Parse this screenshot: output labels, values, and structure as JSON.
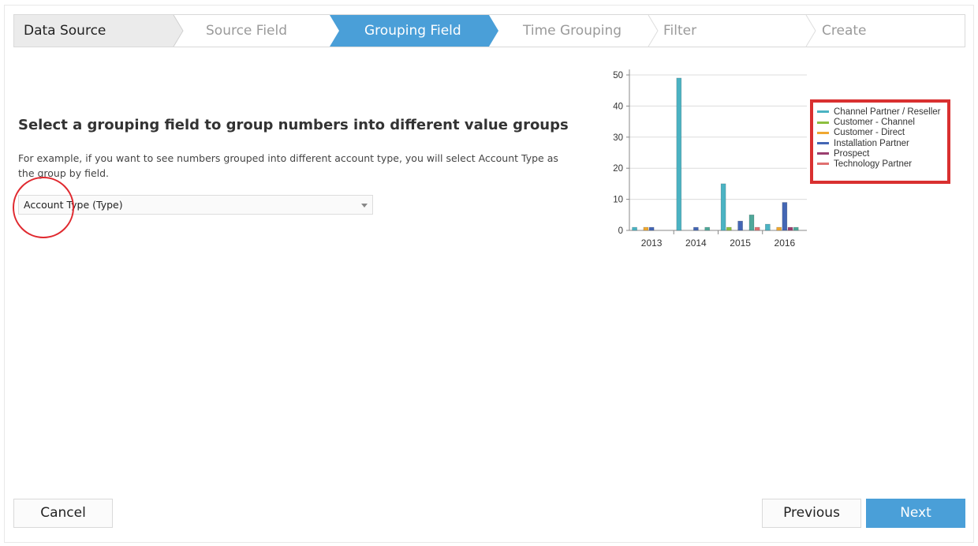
{
  "steps": [
    {
      "label": "Data Source",
      "state": "done"
    },
    {
      "label": "Source Field",
      "state": "pending"
    },
    {
      "label": "Grouping Field",
      "state": "active"
    },
    {
      "label": "Time Grouping",
      "state": "pending"
    },
    {
      "label": "Filter",
      "state": "pending"
    },
    {
      "label": "Create",
      "state": "pending"
    }
  ],
  "main": {
    "heading": "Select a grouping field to group numbers into different value groups",
    "description": "For example, if you want to see numbers grouped into different account type, you will select Account Type as the group by field.",
    "select_value": "Account Type (Type)"
  },
  "chart_data": {
    "type": "bar",
    "categories": [
      "2013",
      "2014",
      "2015",
      "2016"
    ],
    "ylim": [
      0,
      50
    ],
    "yticks": [
      0,
      10,
      20,
      30,
      40,
      50
    ],
    "legend_position": "right",
    "grid": true,
    "series": [
      {
        "name": "Channel Partner / Reseller",
        "color": "#4bb3c3",
        "values": [
          1,
          49,
          15,
          2
        ]
      },
      {
        "name": "Customer - Channel",
        "color": "#8cbf3f",
        "values": [
          0,
          0,
          1,
          0
        ]
      },
      {
        "name": "Customer - Direct",
        "color": "#f0a830",
        "values": [
          1,
          0,
          0,
          1
        ]
      },
      {
        "name": "Installation Partner",
        "color": "#4466b4",
        "values": [
          1,
          1,
          3,
          9
        ]
      },
      {
        "name": "Prospect",
        "color": "#9b3f6f",
        "values": [
          0,
          0,
          0,
          1
        ]
      },
      {
        "name": "Prospect",
        "color": "#4fa89a",
        "values": [
          0,
          1,
          5,
          1
        ]
      },
      {
        "name": "Technology Partner",
        "color": "#e07070",
        "values": [
          0,
          0,
          1,
          0
        ]
      }
    ],
    "legend": [
      {
        "name": "Channel Partner / Reseller",
        "color": "#4bb3c3"
      },
      {
        "name": "Customer - Channel",
        "color": "#8cbf3f"
      },
      {
        "name": "Customer - Direct",
        "color": "#f0a830"
      },
      {
        "name": "Installation Partner",
        "color": "#4466b4"
      },
      {
        "name": "Prospect",
        "color": "#9b3f6f"
      },
      {
        "name": "Technology Partner",
        "color": "#e07070"
      }
    ]
  },
  "footer": {
    "cancel_label": "Cancel",
    "previous_label": "Previous",
    "next_label": "Next"
  },
  "colors": {
    "accent": "#4a9fd8",
    "highlight": "#e0292f"
  }
}
